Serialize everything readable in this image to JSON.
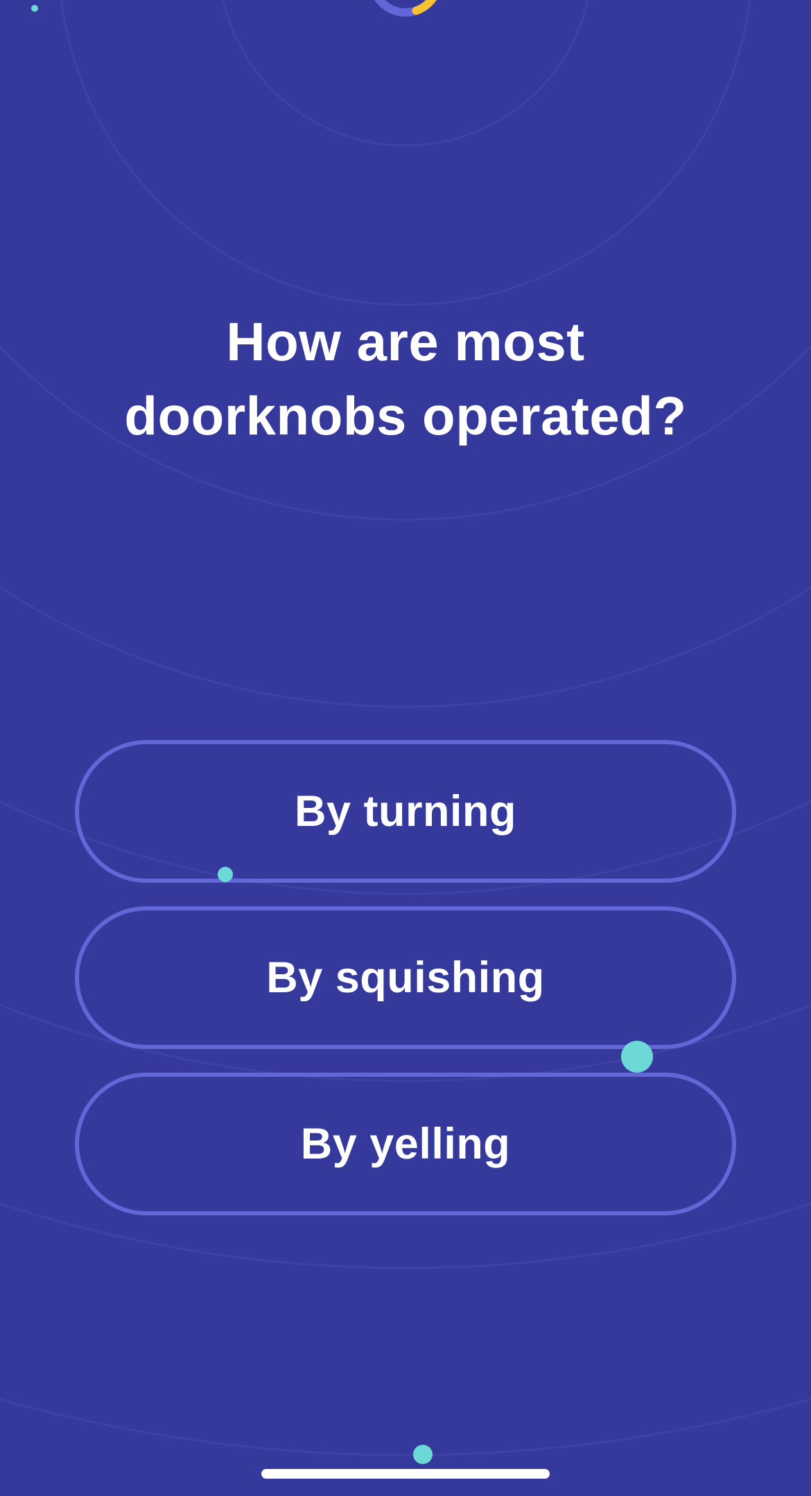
{
  "colors": {
    "background": "#35399b",
    "ring": "#3d42a5",
    "button_border": "#6366d6",
    "timer_track": "#6366d6",
    "timer_progress": "#f6c232",
    "particle": "#6dd9d6",
    "text": "#ffffff"
  },
  "timer": {
    "icon": "countdown-ring-icon",
    "remaining_fraction": 0.2
  },
  "question": {
    "line1": "How are most",
    "line2": "doorknobs operated?"
  },
  "answers": [
    {
      "label": "By turning"
    },
    {
      "label": "By squishing"
    },
    {
      "label": "By yelling"
    }
  ]
}
